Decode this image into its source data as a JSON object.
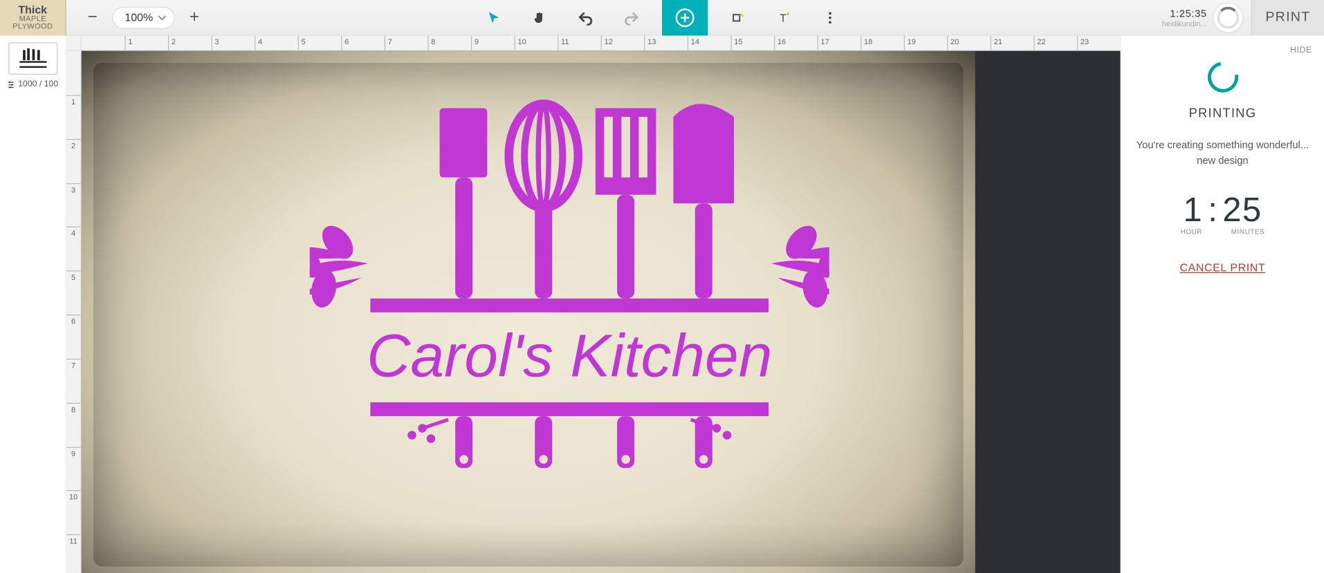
{
  "material": {
    "line1": "Thick",
    "line2": "MAPLE",
    "line3": "PLYWOOD"
  },
  "zoom": {
    "value": "100%"
  },
  "ruler_h": [
    "1",
    "2",
    "3",
    "4",
    "5",
    "6",
    "7",
    "8",
    "9",
    "10",
    "11",
    "12",
    "13",
    "14",
    "15",
    "16",
    "17",
    "18",
    "19",
    "20",
    "21",
    "22",
    "23"
  ],
  "ruler_v": [
    "1",
    "2",
    "3",
    "4",
    "5",
    "6",
    "7",
    "8",
    "9",
    "10",
    "11"
  ],
  "thumb": {
    "meta": "1000 / 100"
  },
  "design_text": "Carol's Kitchen",
  "top_right": {
    "time": "1:25:35",
    "user": "heidikundin..."
  },
  "print_button": "PRINT",
  "panel": {
    "hide": "HIDE",
    "title": "PRINTING",
    "msg1": "You're creating something wonderful...",
    "msg2": "new design",
    "hour": "1",
    "min": "25",
    "hour_label": "HOUR",
    "min_label": "MINUTES",
    "cancel": "CANCEL PRINT"
  }
}
